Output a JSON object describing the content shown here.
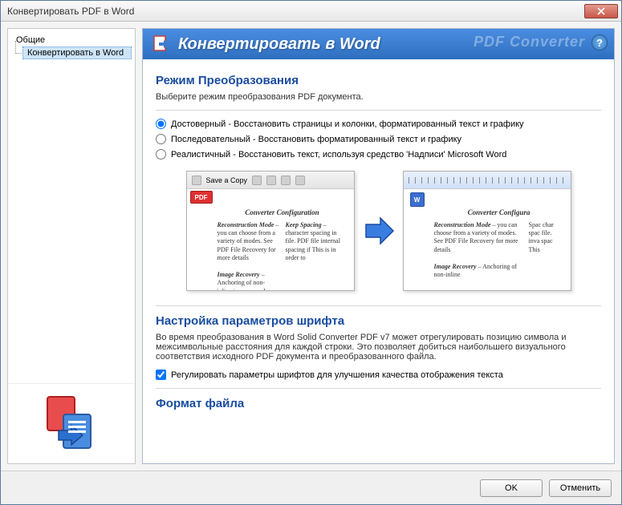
{
  "window": {
    "title": "Конвертировать PDF в Word"
  },
  "sidebar": {
    "items": [
      {
        "label": "Общие"
      },
      {
        "label": "Конвертировать в Word"
      }
    ]
  },
  "banner": {
    "title": "Конвертировать в Word",
    "brand": "PDF Converter"
  },
  "section1": {
    "heading": "Режим Преобразования",
    "desc": "Выберите режим преобразования PDF документа.",
    "options": [
      {
        "label": "Достоверный - Восстановить страницы и колонки, форматированный текст и графику"
      },
      {
        "label": "Последовательный - Восстановить форматированный текст и графику"
      },
      {
        "label": "Реалистичный - Восстановить текст, используя средство 'Надписи' Microsoft Word"
      }
    ]
  },
  "preview": {
    "toolbar_label": "Save a Copy",
    "pdf_badge": "PDF",
    "word_badge": "W",
    "heading": "Converter Configuration",
    "col1_title": "Reconstruction Mode",
    "col1_body": " – you can choose from a variety of modes. See PDF File Recovery for more details",
    "col1_title2": "Image Recovery",
    "col1_body2": " – Anchoring of non-inline images can be",
    "col2_title": "Keep Spacing",
    "col2_body": " – character spacing in file. PDF file internal spacing if This is in order to",
    "right_heading": "Converter Configura",
    "r_col1_title": "Reconstruction Mode",
    "r_col1_body": " – you can choose from a variety of modes. See PDF File Recovery for more details",
    "r_col1_title2": "Image Recovery",
    "r_col1_body2": " – Anchoring of non-inline",
    "r_col2_body": "Spac char spac file. inva spac This"
  },
  "section2": {
    "heading": "Настройка параметров шрифта",
    "desc": "Во время преобразования в Word Solid Converter PDF v7 может отрегулировать позицию символа и межсимвольные расстояния для каждой строки. Это позволяет добиться наибольшего визуального соответствия исходного PDF документа и преобразованного файла.",
    "checkbox": "Регулировать параметры шрифтов для улучшения качества отображения текста"
  },
  "section3": {
    "heading": "Формат файла"
  },
  "footer": {
    "ok": "OK",
    "cancel": "Отменить"
  }
}
